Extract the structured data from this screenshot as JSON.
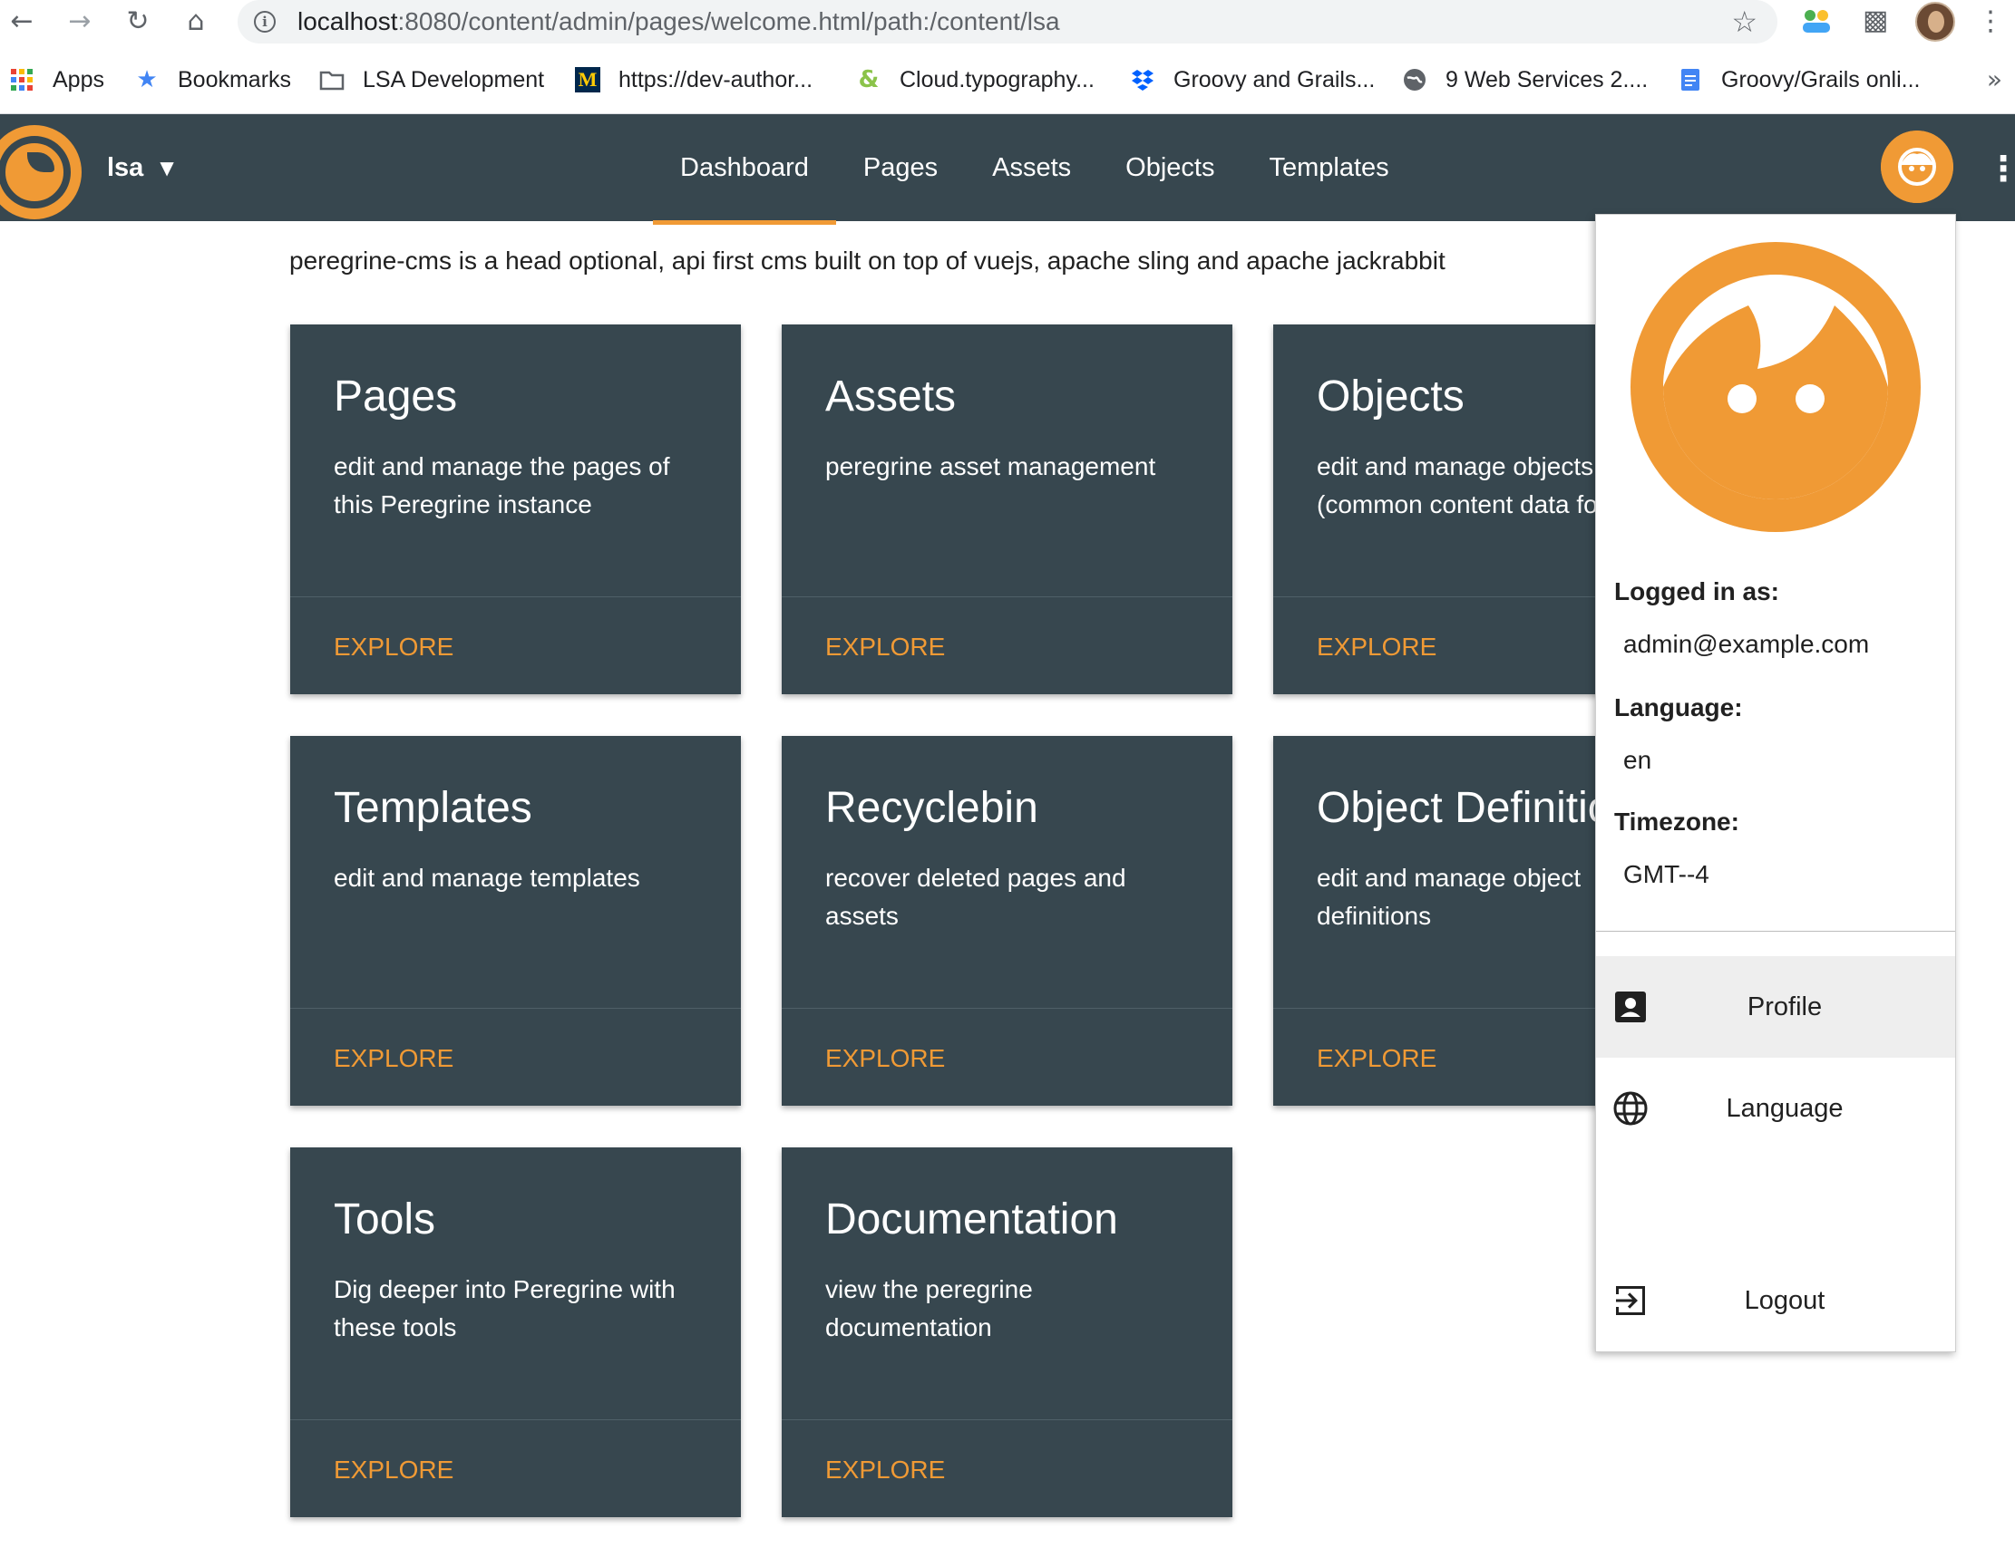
{
  "browser": {
    "url_host": "localhost",
    "url_rest": ":8080/content/admin/pages/welcome.html/path:/content/lsa",
    "bookmarks": [
      {
        "label": "Apps",
        "icon": "apps-grid-icon"
      },
      {
        "label": "Bookmarks",
        "icon": "star-icon"
      },
      {
        "label": "LSA Development",
        "icon": "folder-icon"
      },
      {
        "label": "https://dev-author...",
        "icon": "michigan-m-icon"
      },
      {
        "label": "Cloud.typography...",
        "icon": "ampersand-icon"
      },
      {
        "label": "Groovy and Grails...",
        "icon": "dropbox-icon"
      },
      {
        "label": "9 Web Services 2....",
        "icon": "globe-icon"
      },
      {
        "label": "Groovy/Grails onli...",
        "icon": "docs-icon"
      }
    ]
  },
  "appbar": {
    "site": "lsa",
    "tabs": [
      "Dashboard",
      "Pages",
      "Assets",
      "Objects",
      "Templates"
    ],
    "active_tab": "Dashboard",
    "accent": "#f09a35",
    "bar_color": "#37474f"
  },
  "tagline": "peregrine-cms is a head optional, api first cms built on top of vuejs, apache sling and apache jackrabbit",
  "cards": [
    {
      "title": "Pages",
      "desc": "edit and manage the pages of this Peregrine instance",
      "action": "EXPLORE"
    },
    {
      "title": "Assets",
      "desc": "peregrine asset management",
      "action": "EXPLORE"
    },
    {
      "title": "Objects",
      "desc": "edit and manage objects (common content data for pages)",
      "action": "EXPLORE"
    },
    {
      "title": "Templates",
      "desc": "edit and manage templates",
      "action": "EXPLORE"
    },
    {
      "title": "Recyclebin",
      "desc": "recover deleted pages and assets",
      "action": "EXPLORE"
    },
    {
      "title": "Object Definitions",
      "desc": "edit and manage object definitions",
      "action": "EXPLORE"
    },
    {
      "title": "Tools",
      "desc": "Dig deeper into Peregrine with these tools",
      "action": "EXPLORE"
    },
    {
      "title": "Documentation",
      "desc": "view the peregrine documentation",
      "action": "EXPLORE"
    }
  ],
  "user_menu": {
    "logged_in_label": "Logged in as:",
    "user": "admin@example.com",
    "language_label": "Language:",
    "language": "en",
    "timezone_label": "Timezone:",
    "timezone": "GMT--4",
    "items": [
      {
        "label": "Profile",
        "icon": "account-box-icon"
      },
      {
        "label": "Language",
        "icon": "globe-icon"
      },
      {
        "label": "Logout",
        "icon": "exit-icon"
      }
    ]
  }
}
